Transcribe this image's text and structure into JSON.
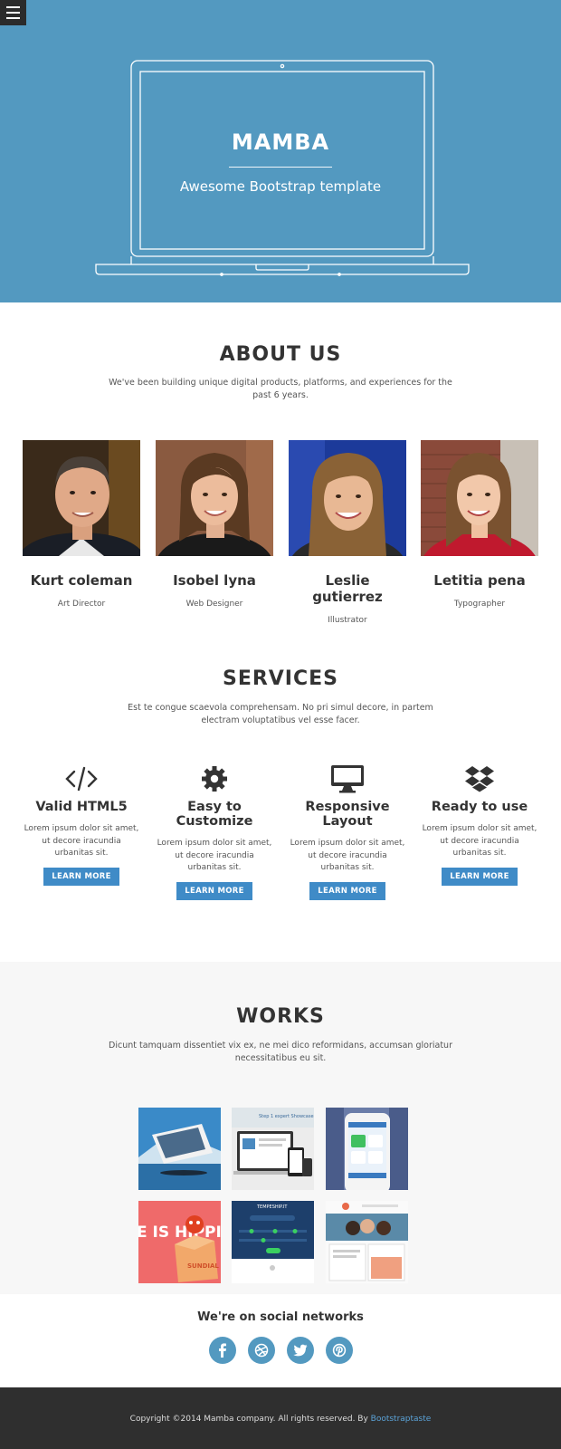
{
  "hero": {
    "title": "MAMBA",
    "subtitle": "Awesome Bootstrap template"
  },
  "about": {
    "title": "ABOUT US",
    "description": "We've been building unique digital products, platforms, and experiences for the past 6 years.",
    "members": [
      {
        "name": "Kurt coleman",
        "role": "Art Director"
      },
      {
        "name": "Isobel lyna",
        "role": "Web Designer"
      },
      {
        "name": "Leslie gutierrez",
        "role": "Illustrator"
      },
      {
        "name": "Letitia pena",
        "role": "Typographer"
      }
    ]
  },
  "services": {
    "title": "SERVICES",
    "description": "Est te congue scaevola comprehensam. No pri simul decore, in partem electram voluptatibus vel esse facer.",
    "items": [
      {
        "icon": "code-icon",
        "title": "Valid HTML5",
        "text": "Lorem ipsum dolor sit amet, ut decore iracundia urbanitas sit.",
        "button": "LEARN MORE"
      },
      {
        "icon": "gear-icon",
        "title": "Easy to Customize",
        "text": "Lorem ipsum dolor sit amet, ut decore iracundia urbanitas sit.",
        "button": "LEARN MORE"
      },
      {
        "icon": "desktop-icon",
        "title": "Responsive Layout",
        "text": "Lorem ipsum dolor sit amet, ut decore iracundia urbanitas sit.",
        "button": "LEARN MORE"
      },
      {
        "icon": "dropbox-icon",
        "title": "Ready to use",
        "text": "Lorem ipsum dolor sit amet, ut decore iracundia urbanitas sit.",
        "button": "LEARN MORE"
      }
    ]
  },
  "works": {
    "title": "WORKS",
    "description": "Dicunt tamquam dissentiet vix ex, ne mei dico reformidans, accumsan gloriatur necessitatibus eu sit.",
    "thumb_texts": {
      "step1": "Step 1 expert Showcase",
      "shipping": "E IS HIPPING WAY",
      "box": "SUNDIAL",
      "ship": "TEMPESHIP.IT"
    }
  },
  "social": {
    "title": "We're on social networks",
    "icons": [
      "facebook-icon",
      "dribbble-icon",
      "twitter-icon",
      "pinterest-icon"
    ]
  },
  "footer": {
    "text": "Copyright ©2014 Mamba company. All rights reserved. By ",
    "link": "Bootstraptaste"
  },
  "colors": {
    "accent": "#5399c0",
    "button": "#3f8bc7",
    "footer_bg": "#2f2f2f",
    "works_bg": "#f7f7f7"
  }
}
